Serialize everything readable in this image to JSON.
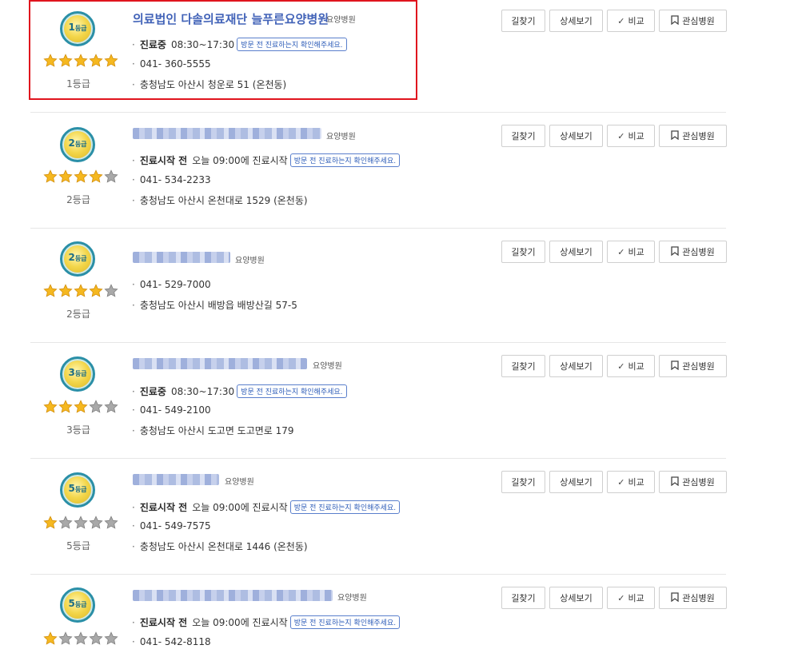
{
  "buttons": {
    "directions": "길찾기",
    "details": "상세보기",
    "compare": "비교",
    "favorite": "관심병원"
  },
  "notice_badge": "방문 전 진료하는지 확인해주세요.",
  "colors": {
    "highlight_border": "#e0141e",
    "name_link": "#4263b8",
    "badge": "#2d5cb8",
    "star_on": "#f5b820",
    "star_off": "#a9a9a9"
  },
  "items": [
    {
      "grade_num": "1",
      "grade_suffix": "등급",
      "grade_label": "1등급",
      "stars": 5,
      "name": "의료법인 다솔의료재단 늘푸른요양병원",
      "type": "요양병원",
      "status": "진료중",
      "hours": "08:30~17:30",
      "phone": "041- 360-5555",
      "address": "충청남도 아산시 청운로 51 (온천동)"
    },
    {
      "grade_num": "2",
      "grade_suffix": "등급",
      "grade_label": "2등급",
      "stars": 4,
      "name": "",
      "type": "요양병원",
      "status": "진료시작 전",
      "hours": "오늘 09:00에 진료시작",
      "phone": "041- 534-2233",
      "address": "충청남도 아산시 온천대로 1529 (온천동)"
    },
    {
      "grade_num": "2",
      "grade_suffix": "등급",
      "grade_label": "2등급",
      "stars": 4,
      "name": "",
      "type": "요양병원",
      "phone": "041- 529-7000",
      "address": "충청남도 아산시 배방읍 배방산길 57-5"
    },
    {
      "grade_num": "3",
      "grade_suffix": "등급",
      "grade_label": "3등급",
      "stars": 3,
      "name": "",
      "type": "요양병원",
      "status": "진료중",
      "hours": "08:30~17:30",
      "phone": "041- 549-2100",
      "address": "충청남도 아산시 도고면 도고면로 179"
    },
    {
      "grade_num": "5",
      "grade_suffix": "등급",
      "grade_label": "5등급",
      "stars": 1,
      "name": "",
      "type": "요양병원",
      "status": "진료시작 전",
      "hours": "오늘 09:00에 진료시작",
      "phone": "041- 549-7575",
      "address": "충청남도 아산시 온천대로 1446 (온천동)"
    },
    {
      "grade_num": "5",
      "grade_suffix": "등급",
      "grade_label": "",
      "stars": 1,
      "name": "",
      "type": "요양병원",
      "status": "진료시작 전",
      "hours": "오늘 09:00에 진료시작",
      "phone": "041- 542-8118",
      "address": ""
    }
  ]
}
